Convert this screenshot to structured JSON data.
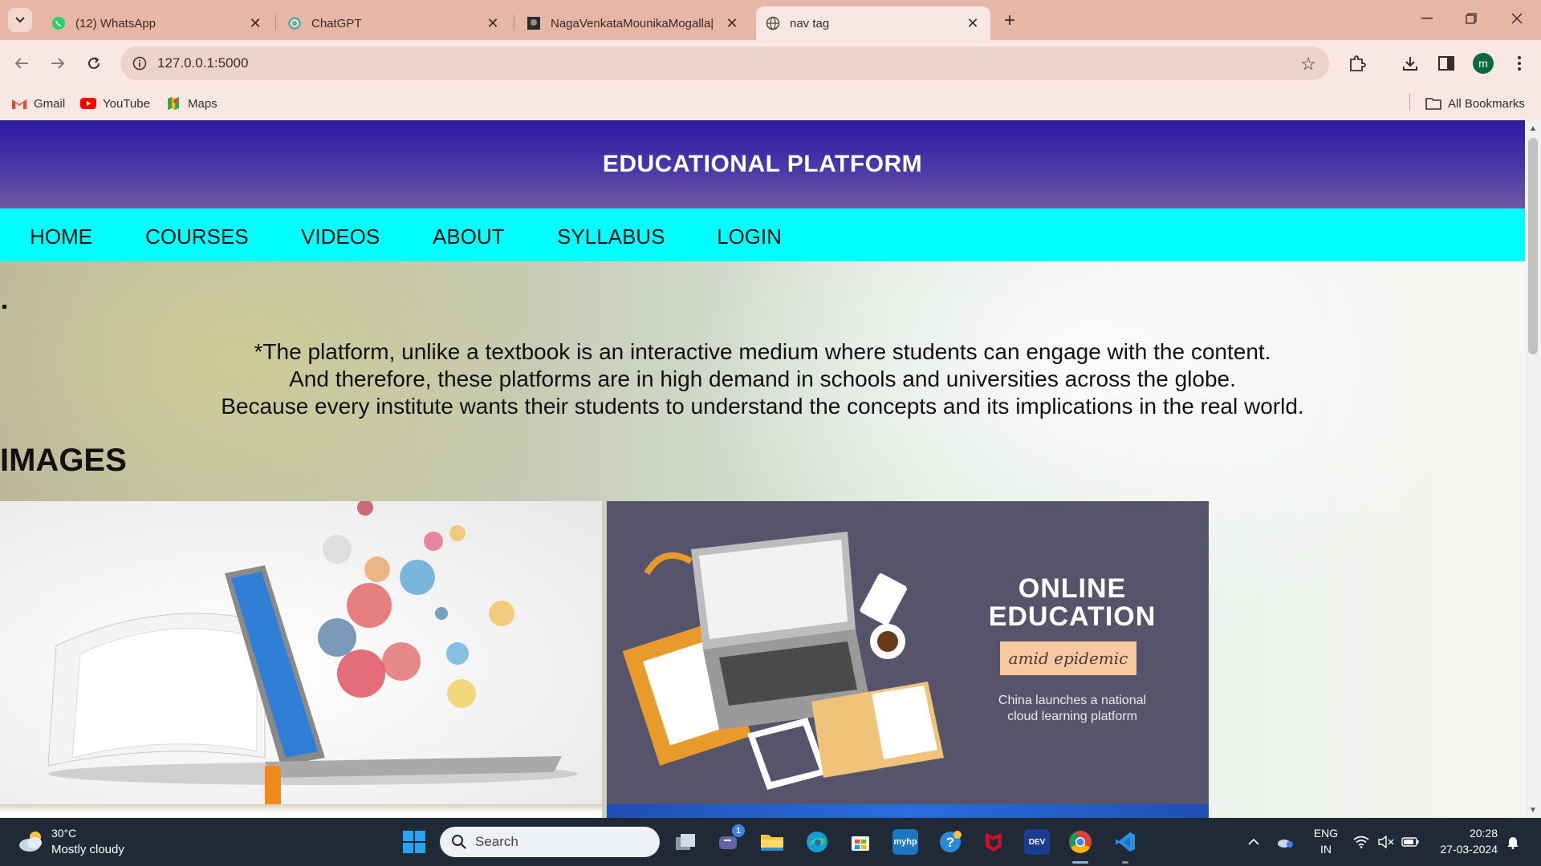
{
  "browser": {
    "tabs": [
      {
        "title": "(12) WhatsApp",
        "icon": "whatsapp-icon",
        "active": false
      },
      {
        "title": "ChatGPT",
        "icon": "chatgpt-icon",
        "active": false
      },
      {
        "title": "NagaVenkataMounikaMogalla|",
        "icon": "github-avatar-icon",
        "active": false
      },
      {
        "title": "nav tag",
        "icon": "globe-icon",
        "active": true
      }
    ],
    "url": "127.0.0.1:5000",
    "profile_initial": "m",
    "bookmarks": [
      {
        "label": "Gmail",
        "icon": "gmail-icon"
      },
      {
        "label": "YouTube",
        "icon": "youtube-icon"
      },
      {
        "label": "Maps",
        "icon": "maps-icon"
      }
    ],
    "all_bookmarks_label": "All Bookmarks"
  },
  "page": {
    "header_title": "EDUCATIONAL PLATFORM",
    "nav": [
      "HOME",
      "COURSES",
      "VIDEOS",
      "ABOUT",
      "SYLLABUS",
      "LOGIN"
    ],
    "bullet": ".",
    "intro_lines": [
      "*The platform, unlike a textbook is an interactive medium where students can engage with the content.",
      "And therefore, these platforms are in high demand in schools and universities across the globe.",
      "Because every institute wants their students to understand the concepts and its implications in the real world."
    ],
    "images_heading": "IMAGES",
    "image2": {
      "line1": "ONLINE",
      "line2": "EDUCATION",
      "ribbon": "amid epidemic",
      "caption1": "China launches a national",
      "caption2": "cloud learning platform"
    }
  },
  "taskbar": {
    "weather_temp": "30°C",
    "weather_desc": "Mostly cloudy",
    "search_label": "Search",
    "teams_badge": "1",
    "lang1": "ENG",
    "lang2": "IN",
    "time": "20:28",
    "date": "27-03-2024"
  },
  "colors": {
    "header_gradient_top": "#2c1aa6",
    "nav_background": "#00ffff",
    "tabstrip": "#e6b6a6",
    "taskbar": "#202a36"
  }
}
